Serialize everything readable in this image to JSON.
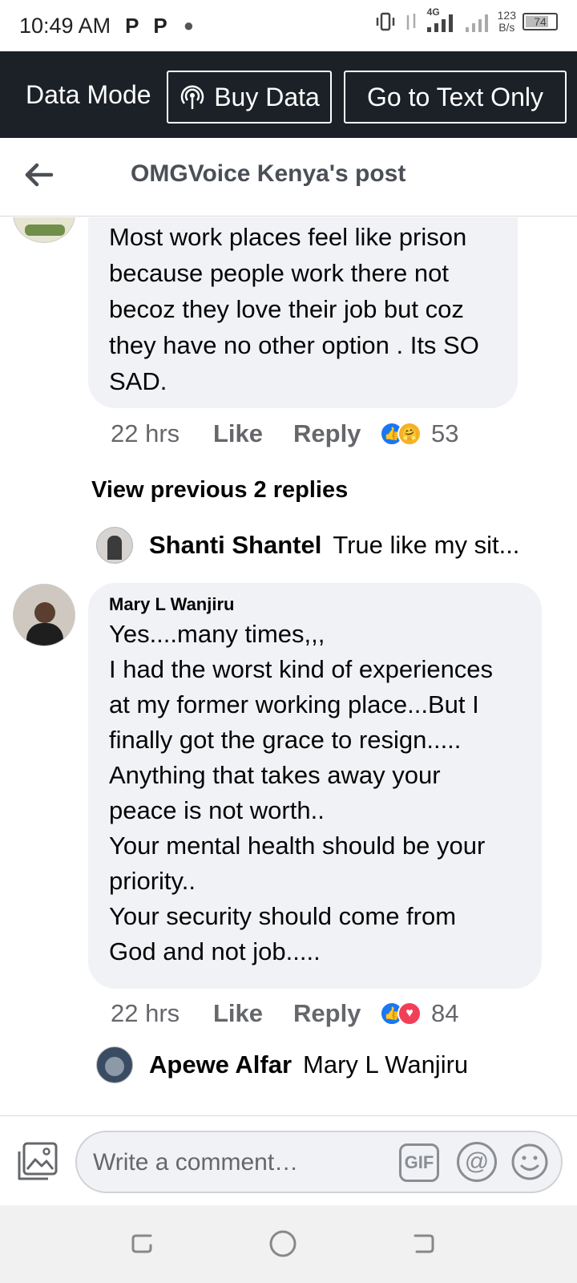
{
  "status_bar": {
    "time": "10:49 AM",
    "icons": [
      "p-notification-icon",
      "p-notification-icon",
      "dot-icon",
      "vibrate-icon",
      "data-arrows-icon",
      "signal-4g-icon",
      "signal-icon"
    ],
    "network_type": "4G",
    "net_speed_value": "123",
    "net_speed_unit": "B/s",
    "battery": "74"
  },
  "data_bar": {
    "label": "Data Mode",
    "buy_data": "Buy Data",
    "text_only": "Go to Text Only"
  },
  "header": {
    "title": "OMGVoice Kenya's post"
  },
  "comments": [
    {
      "text": "Most work places feel like prison\nbecause people work there not\nbecoz they love their job but coz\nthey have no other option . Its SO\nSAD.",
      "time": "22 hrs",
      "like": "Like",
      "reply": "Reply",
      "reactions": [
        "like",
        "care"
      ],
      "reaction_count": "53"
    },
    {
      "author": "Mary L Wanjiru",
      "text": "Yes....many times,,,\nI had the worst kind of experiences\nat my former working place...But I\nfinally got the grace to resign.....\nAnything that takes away your\npeace is not worth..\nYour mental health should be your\npriority..\nYour security should come from\nGod and not job.....",
      "time": "22 hrs",
      "like": "Like",
      "reply": "Reply",
      "reactions": [
        "like",
        "love"
      ],
      "reaction_count": "84"
    }
  ],
  "view_previous": "View previous 2 replies",
  "reply_previews": [
    {
      "name": "Shanti Shantel",
      "snippet": "True like my sit..."
    },
    {
      "name": "Apewe Alfar",
      "snippet": "Mary L Wanjiru"
    }
  ],
  "composer": {
    "placeholder": "Write a comment…",
    "gif": "GIF",
    "mention": "@"
  },
  "colors": {
    "data_bar_bg": "#1c2128",
    "bubble_bg": "#f0f2f5",
    "like_blue": "#1877f2",
    "love_red": "#f33e58",
    "care_yellow": "#f7b125",
    "meta_gray": "#65676b"
  }
}
